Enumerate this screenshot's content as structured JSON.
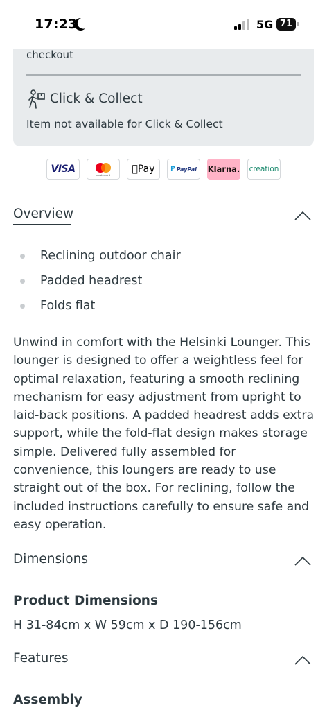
{
  "status_bar": {
    "time": "17:23",
    "network": "5G",
    "battery": "71"
  },
  "delivery_card": {
    "top_text": "checkout",
    "click_collect_title": "Click & Collect",
    "click_collect_status": "Item not available for Click & Collect"
  },
  "payments": [
    "VISA",
    "mastercard",
    "Pay",
    "PayPal",
    "Klarna.",
    "creation"
  ],
  "overview": {
    "title": "Overview",
    "bullets": [
      "Reclining outdoor chair",
      "Padded headrest",
      "Folds flat"
    ],
    "description": "Unwind in comfort with the Helsinki Lounger. This lounger is designed to offer a weightless feel for optimal relaxation, featuring a smooth reclining mechanism for easy adjustment from upright to laid-back positions. A padded headrest adds extra support, while the fold-flat design makes storage simple. Delivered fully assembled for convenience, this loungers are ready to use straight out of the box. For reclining, follow the included instructions carefully to ensure safe and easy operation."
  },
  "dimensions": {
    "title": "Dimensions",
    "subtitle": "Product Dimensions",
    "value": "H 31-84cm x W 59cm x D 190-156cm"
  },
  "features": {
    "title": "Features",
    "subtitle": "Assembly"
  },
  "icons": {
    "moon": "moon-icon",
    "signal": "signal-icon",
    "click_collect": "click-collect-icon",
    "chevron": "chevron-up-icon"
  },
  "colors": {
    "text": "#2e3a40",
    "card_bg": "#e8ebed",
    "klarna_pink": "#ffb3c7"
  }
}
